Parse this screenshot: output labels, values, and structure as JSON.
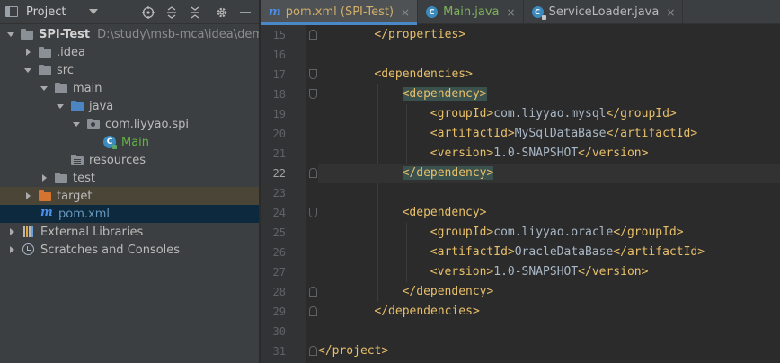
{
  "project_pane": {
    "title": "Project",
    "tree": [
      {
        "label": "SPI-Test",
        "path": "D:\\study\\msb-mca\\idea\\demo\\S"
      },
      {
        "label": ".idea"
      },
      {
        "label": "src"
      },
      {
        "label": "main"
      },
      {
        "label": "java"
      },
      {
        "label": "com.liyyao.spi"
      },
      {
        "label": "Main"
      },
      {
        "label": "resources"
      },
      {
        "label": "test"
      },
      {
        "label": "target"
      },
      {
        "label": "pom.xml"
      },
      {
        "label": "External Libraries"
      },
      {
        "label": "Scratches and Consoles"
      }
    ]
  },
  "editor": {
    "tabs": [
      {
        "label": "pom.xml (SPI-Test)",
        "close": "×"
      },
      {
        "label": "Main.java",
        "close": "×"
      },
      {
        "label": "ServiceLoader.java",
        "close": "×"
      }
    ],
    "lines": [
      {
        "num": "15",
        "open": "",
        "text": "</properties>",
        "close": ""
      },
      {
        "num": "16",
        "open": "",
        "text": "",
        "close": ""
      },
      {
        "num": "17",
        "open": "",
        "text": "<dependencies>",
        "close": ""
      },
      {
        "num": "18",
        "open": "",
        "text": "<dependency>",
        "close": ""
      },
      {
        "num": "19",
        "open": "<groupId>",
        "text": "com.liyyao.mysql",
        "close": "</groupId>"
      },
      {
        "num": "20",
        "open": "<artifactId>",
        "text": "MySqlDataBase",
        "close": "</artifactId>"
      },
      {
        "num": "21",
        "open": "<version>",
        "text": "1.0-SNAPSHOT",
        "close": "</version>"
      },
      {
        "num": "22",
        "open": "",
        "text": "</dependency>",
        "close": ""
      },
      {
        "num": "23",
        "open": "",
        "text": "",
        "close": ""
      },
      {
        "num": "24",
        "open": "",
        "text": "<dependency>",
        "close": ""
      },
      {
        "num": "25",
        "open": "<groupId>",
        "text": "com.liyyao.oracle",
        "close": "</groupId>"
      },
      {
        "num": "26",
        "open": "<artifactId>",
        "text": "OracleDataBase",
        "close": "</artifactId>"
      },
      {
        "num": "27",
        "open": "<version>",
        "text": "1.0-SNAPSHOT",
        "close": "</version>"
      },
      {
        "num": "28",
        "open": "",
        "text": "</dependency>",
        "close": ""
      },
      {
        "num": "29",
        "open": "",
        "text": "</dependencies>",
        "close": ""
      },
      {
        "num": "30",
        "open": "",
        "text": "",
        "close": ""
      },
      {
        "num": "31",
        "open": "",
        "text": "</project>",
        "close": ""
      }
    ],
    "current_line": "22"
  },
  "colors": {
    "xml_tag": "#e8bf6a",
    "xml_text": "#a9b7c6",
    "tag_match_highlight": "#3b514d",
    "selected_row": "#0d293e",
    "active_tab_underline": "#4a88c7"
  }
}
